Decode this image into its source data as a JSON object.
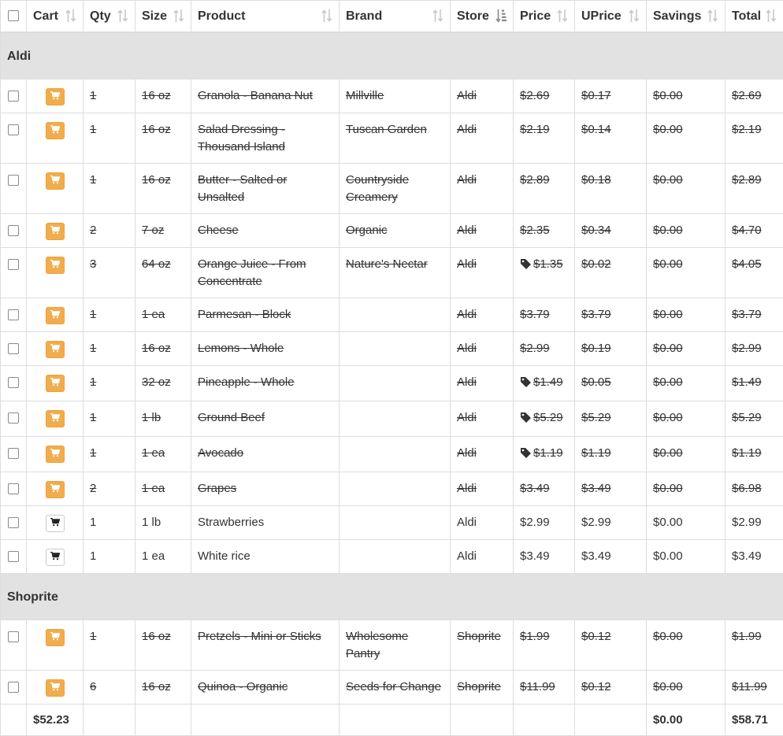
{
  "columns": {
    "cart": "Cart",
    "qty": "Qty",
    "size": "Size",
    "product": "Product",
    "brand": "Brand",
    "store": "Store",
    "price": "Price",
    "uprice": "UPrice",
    "savings": "Savings",
    "total": "Total"
  },
  "colors": {
    "cart_active": "#f0ad4e",
    "group_bg": "#e2e2e2",
    "border": "#dddddd"
  },
  "groups": [
    {
      "name": "Aldi",
      "rows": [
        {
          "done": true,
          "qty": "1",
          "size": "16 oz",
          "product": "Granola - Banana Nut",
          "brand": "Millville",
          "store": "Aldi",
          "sale": false,
          "price": "$2.69",
          "uprice": "$0.17",
          "savings": "$0.00",
          "total": "$2.69"
        },
        {
          "done": true,
          "qty": "1",
          "size": "16 oz",
          "product": "Salad Dressing - Thousand Island",
          "brand": "Tuscan Garden",
          "store": "Aldi",
          "sale": false,
          "price": "$2.19",
          "uprice": "$0.14",
          "savings": "$0.00",
          "total": "$2.19"
        },
        {
          "done": true,
          "qty": "1",
          "size": "16 oz",
          "product": "Butter - Salted or Unsalted",
          "brand": "Countryside Creamery",
          "store": "Aldi",
          "sale": false,
          "price": "$2.89",
          "uprice": "$0.18",
          "savings": "$0.00",
          "total": "$2.89"
        },
        {
          "done": true,
          "qty": "2",
          "size": "7 oz",
          "product": "Cheese",
          "brand": "Organic",
          "store": "Aldi",
          "sale": false,
          "price": "$2.35",
          "uprice": "$0.34",
          "savings": "$0.00",
          "total": "$4.70"
        },
        {
          "done": true,
          "qty": "3",
          "size": "64 oz",
          "product": "Orange Juice - From Concentrate",
          "brand": "Nature's Nectar",
          "store": "Aldi",
          "sale": true,
          "price": "$1.35",
          "uprice": "$0.02",
          "savings": "$0.00",
          "total": "$4.05"
        },
        {
          "done": true,
          "qty": "1",
          "size": "1 ea",
          "product": "Parmesan - Block",
          "brand": "",
          "store": "Aldi",
          "sale": false,
          "price": "$3.79",
          "uprice": "$3.79",
          "savings": "$0.00",
          "total": "$3.79"
        },
        {
          "done": true,
          "qty": "1",
          "size": "16 oz",
          "product": "Lemons - Whole",
          "brand": "",
          "store": "Aldi",
          "sale": false,
          "price": "$2.99",
          "uprice": "$0.19",
          "savings": "$0.00",
          "total": "$2.99"
        },
        {
          "done": true,
          "qty": "1",
          "size": "32 oz",
          "product": "Pineapple - Whole",
          "brand": "",
          "store": "Aldi",
          "sale": true,
          "price": "$1.49",
          "uprice": "$0.05",
          "savings": "$0.00",
          "total": "$1.49"
        },
        {
          "done": true,
          "qty": "1",
          "size": "1 lb",
          "product": "Ground Beef",
          "brand": "",
          "store": "Aldi",
          "sale": true,
          "price": "$5.29",
          "uprice": "$5.29",
          "savings": "$0.00",
          "total": "$5.29"
        },
        {
          "done": true,
          "qty": "1",
          "size": "1 ea",
          "product": "Avocado",
          "brand": "",
          "store": "Aldi",
          "sale": true,
          "price": "$1.19",
          "uprice": "$1.19",
          "savings": "$0.00",
          "total": "$1.19"
        },
        {
          "done": true,
          "qty": "2",
          "size": "1 ea",
          "product": "Grapes",
          "brand": "",
          "store": "Aldi",
          "sale": false,
          "price": "$3.49",
          "uprice": "$3.49",
          "savings": "$0.00",
          "total": "$6.98"
        },
        {
          "done": false,
          "qty": "1",
          "size": "1 lb",
          "product": "Strawberries",
          "brand": "",
          "store": "Aldi",
          "sale": false,
          "price": "$2.99",
          "uprice": "$2.99",
          "savings": "$0.00",
          "total": "$2.99"
        },
        {
          "done": false,
          "qty": "1",
          "size": "1 ea",
          "product": "White rice",
          "brand": "",
          "store": "Aldi",
          "sale": false,
          "price": "$3.49",
          "uprice": "$3.49",
          "savings": "$0.00",
          "total": "$3.49"
        }
      ]
    },
    {
      "name": "Shoprite",
      "rows": [
        {
          "done": true,
          "qty": "1",
          "size": "16 oz",
          "product": "Pretzels - Mini or Sticks",
          "brand": "Wholesome Pantry",
          "store": "Shoprite",
          "sale": false,
          "price": "$1.99",
          "uprice": "$0.12",
          "savings": "$0.00",
          "total": "$1.99"
        },
        {
          "done": true,
          "qty": "6",
          "size": "16 oz",
          "product": "Quinoa - Organic",
          "brand": "Seeds for Change",
          "store": "Shoprite",
          "sale": false,
          "price": "$11.99",
          "uprice": "$0.12",
          "savings": "$0.00",
          "total": "$11.99"
        }
      ]
    }
  ],
  "footer": {
    "cart_total": "$52.23",
    "savings_total": "$0.00",
    "grand_total": "$58.71"
  }
}
